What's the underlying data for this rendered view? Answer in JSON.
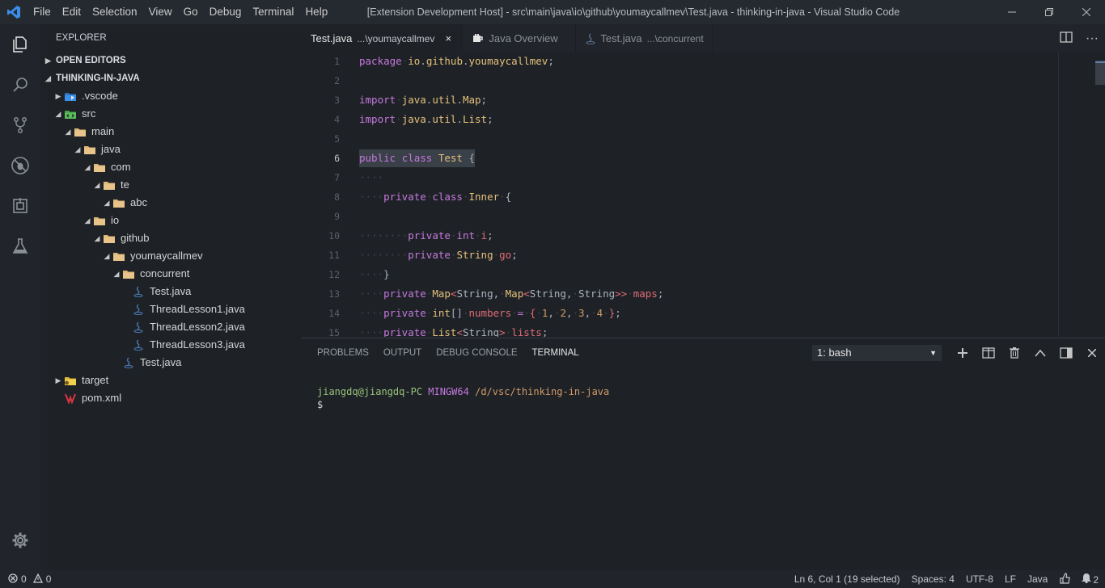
{
  "titlebar": {
    "menu": [
      "File",
      "Edit",
      "Selection",
      "View",
      "Go",
      "Debug",
      "Terminal",
      "Help"
    ],
    "title": "[Extension Development Host] - src\\main\\java\\io\\github\\youmaycallmev\\Test.java - thinking-in-java - Visual Studio Code"
  },
  "sidebar": {
    "header": "EXPLORER",
    "open_editors": "OPEN EDITORS",
    "project": "THINKING-IN-JAVA",
    "tree": [
      {
        "label": ".vscode",
        "depth": 0,
        "twisty": "▶",
        "icon": "vscode-folder-icon"
      },
      {
        "label": "src",
        "depth": 0,
        "twisty": "◢",
        "icon": "src-folder-icon"
      },
      {
        "label": "main",
        "depth": 1,
        "twisty": "◢",
        "icon": "folder-icon"
      },
      {
        "label": "java",
        "depth": 2,
        "twisty": "◢",
        "icon": "folder-icon"
      },
      {
        "label": "com",
        "depth": 3,
        "twisty": "◢",
        "icon": "folder-icon"
      },
      {
        "label": "te",
        "depth": 4,
        "twisty": "◢",
        "icon": "folder-icon"
      },
      {
        "label": "abc",
        "depth": 5,
        "twisty": "◢",
        "icon": "folder-icon"
      },
      {
        "label": "io",
        "depth": 3,
        "twisty": "◢",
        "icon": "folder-icon"
      },
      {
        "label": "github",
        "depth": 4,
        "twisty": "◢",
        "icon": "folder-icon"
      },
      {
        "label": "youmaycallmev",
        "depth": 5,
        "twisty": "◢",
        "icon": "folder-icon"
      },
      {
        "label": "concurrent",
        "depth": 6,
        "twisty": "◢",
        "icon": "folder-icon"
      },
      {
        "label": "Test.java",
        "depth": 7,
        "twisty": "",
        "icon": "java-file-icon"
      },
      {
        "label": "ThreadLesson1.java",
        "depth": 7,
        "twisty": "",
        "icon": "java-file-icon"
      },
      {
        "label": "ThreadLesson2.java",
        "depth": 7,
        "twisty": "",
        "icon": "java-file-icon"
      },
      {
        "label": "ThreadLesson3.java",
        "depth": 7,
        "twisty": "",
        "icon": "java-file-icon"
      },
      {
        "label": "Test.java",
        "depth": 6,
        "twisty": "",
        "icon": "java-file-icon"
      },
      {
        "label": "target",
        "depth": 0,
        "twisty": "▶",
        "icon": "target-folder-icon"
      },
      {
        "label": "pom.xml",
        "depth": 0,
        "twisty": "",
        "icon": "maven-file-icon"
      }
    ]
  },
  "tabs": [
    {
      "name": "Test.java",
      "desc": "...\\youmaycallmev",
      "close": "×"
    },
    {
      "name": "Java Overview",
      "desc": ""
    },
    {
      "name": "Test.java",
      "desc": "...\\concurrent"
    }
  ],
  "editor": {
    "line_numbers": [
      "1",
      "2",
      "3",
      "4",
      "5",
      "6",
      "7",
      "8",
      "9",
      "10",
      "11",
      "12",
      "13",
      "14",
      "15"
    ],
    "current_line": "6"
  },
  "panel": {
    "tabs": [
      "PROBLEMS",
      "OUTPUT",
      "DEBUG CONSOLE",
      "TERMINAL"
    ],
    "terminal_select": "1: bash",
    "terminal": {
      "user": "jiangdq@jiangdq-PC",
      "host": "MINGW64",
      "path": "/d/vsc/thinking-in-java",
      "prompt": "$"
    }
  },
  "statusbar": {
    "errors": "0",
    "warnings": "0",
    "position": "Ln 6, Col 1 (19 selected)",
    "spaces": "Spaces: 4",
    "encoding": "UTF-8",
    "eol": "LF",
    "language": "Java",
    "notifications": "2"
  },
  "colors": {
    "folder": "#dcb67a",
    "java": "#4b7bb5",
    "keyword": "#c678dd",
    "type": "#e5c07b",
    "variable": "#e06c75",
    "number": "#d19a66"
  }
}
